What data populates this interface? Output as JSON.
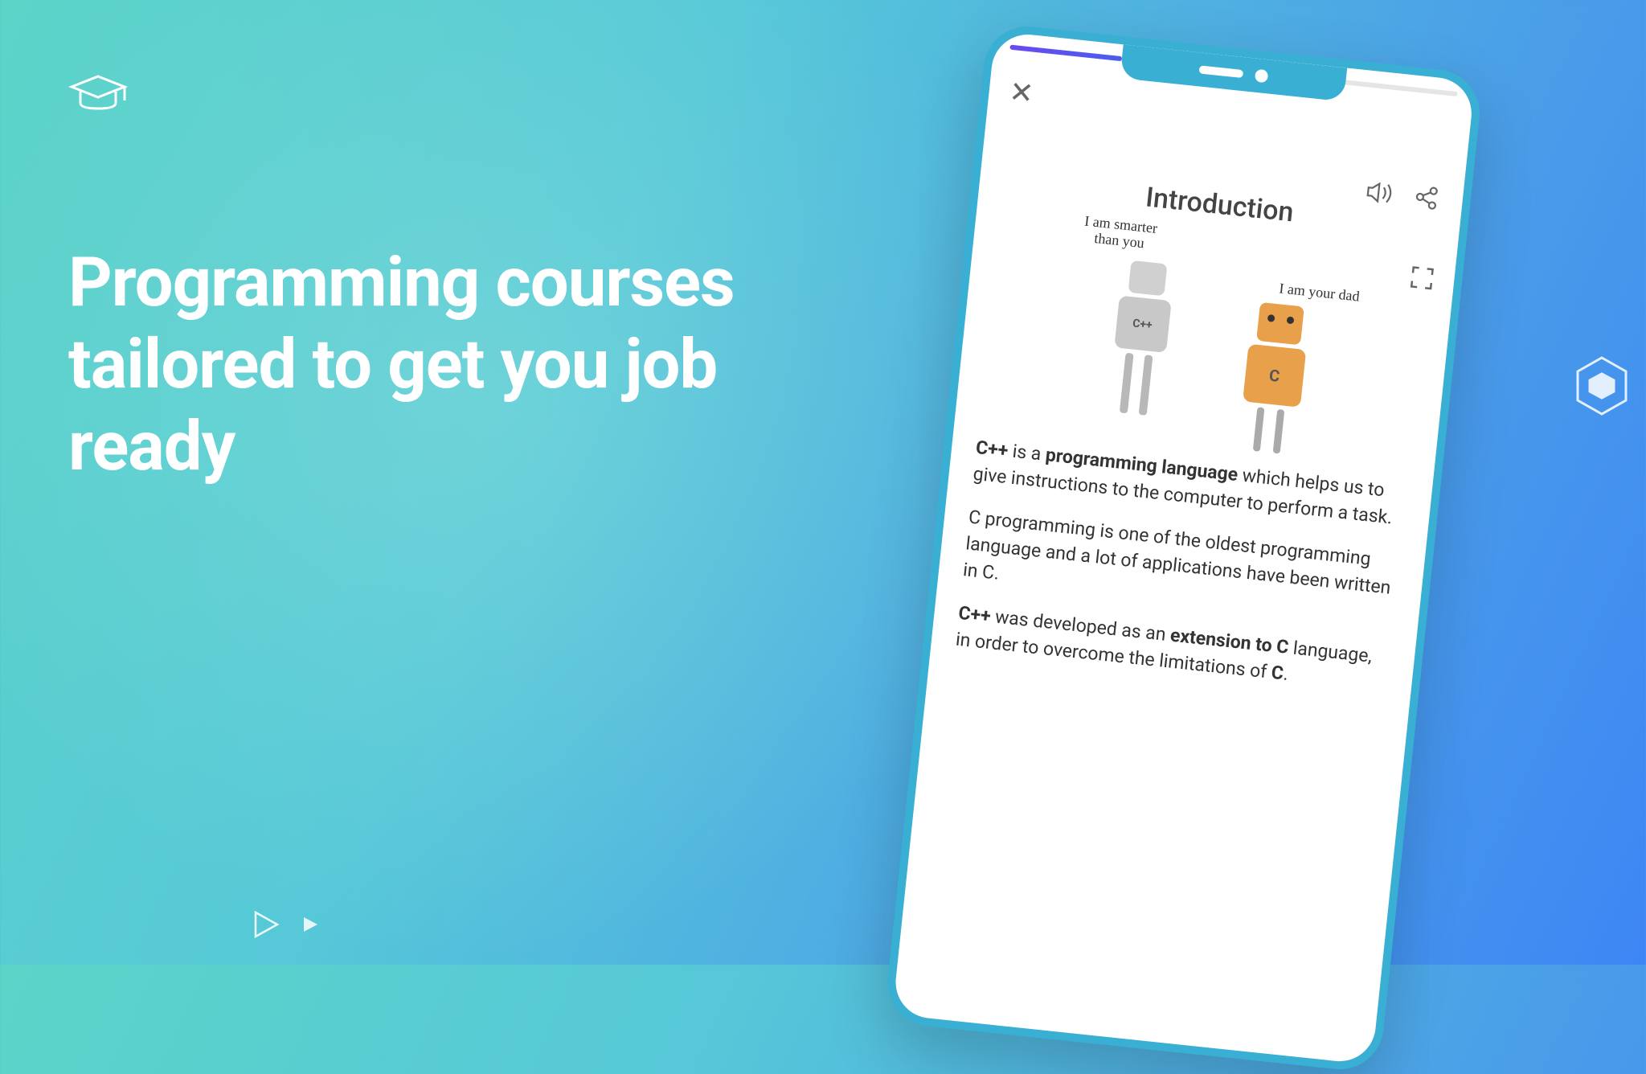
{
  "headline": "Programming courses tailored to get you job ready",
  "phone": {
    "title": "Introduction",
    "speech1": "I am smarter\nthan you",
    "speech2": "I am your dad",
    "robot1_label": "C++",
    "robot2_label": "C",
    "p1_pre": "C++",
    "p1_mid": " is a ",
    "p1_bold": "programming language",
    "p1_post": " which helps us to give instructions to the computer to perform a task.",
    "p2": "C programming is one of the oldest programming language and a lot of applications have been written in C.",
    "p3_pre": "C++",
    "p3_mid": " was developed as an ",
    "p3_bold": "extension to C",
    "p3_post": " language, in order to overcome the limitations of ",
    "p3_end": "C",
    "p3_dot": "."
  }
}
